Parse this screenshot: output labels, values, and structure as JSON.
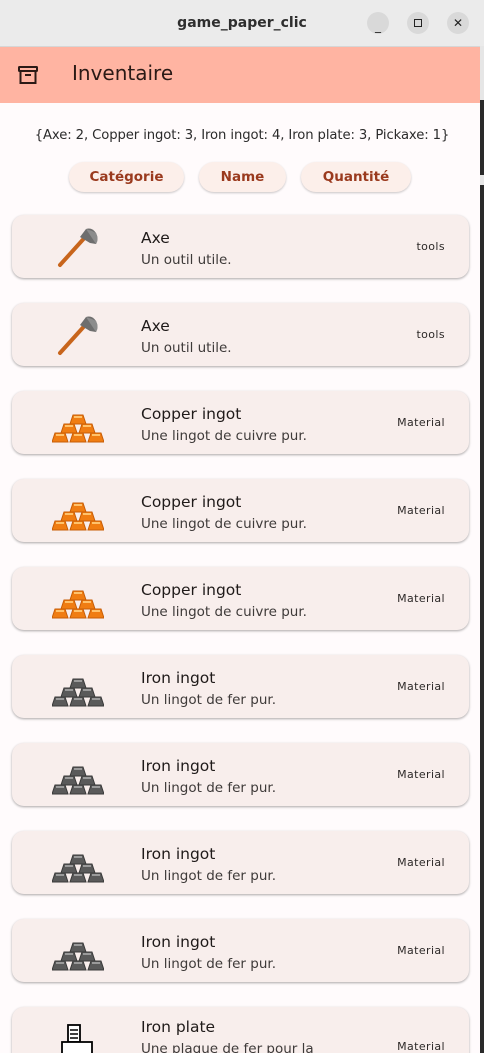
{
  "window": {
    "title": "game_paper_clic",
    "minimize_glyph": "_",
    "close_glyph": "✕"
  },
  "appbar": {
    "title": "Inventaire",
    "icon": "archive-icon",
    "background": "#ffb4a2"
  },
  "summary": "{Axe: 2, Copper ingot: 3, Iron ingot: 4, Iron plate: 3, Pickaxe: 1}",
  "sort_buttons": {
    "category": "Catégorie",
    "name": "Name",
    "quantity": "Quantité"
  },
  "items": [
    {
      "name": "Axe",
      "description": "Un outil utile.",
      "category": "tools",
      "icon": "axe-icon"
    },
    {
      "name": "Axe",
      "description": "Un outil utile.",
      "category": "tools",
      "icon": "axe-icon"
    },
    {
      "name": "Copper ingot",
      "description": "Une lingot de cuivre pur.",
      "category": "Material",
      "icon": "copper-ingot-icon"
    },
    {
      "name": "Copper ingot",
      "description": "Une lingot de cuivre pur.",
      "category": "Material",
      "icon": "copper-ingot-icon"
    },
    {
      "name": "Copper ingot",
      "description": "Une lingot de cuivre pur.",
      "category": "Material",
      "icon": "copper-ingot-icon"
    },
    {
      "name": "Iron ingot",
      "description": "Un lingot de fer pur.",
      "category": "Material",
      "icon": "iron-ingot-icon"
    },
    {
      "name": "Iron ingot",
      "description": "Un lingot de fer pur.",
      "category": "Material",
      "icon": "iron-ingot-icon"
    },
    {
      "name": "Iron ingot",
      "description": "Un lingot de fer pur.",
      "category": "Material",
      "icon": "iron-ingot-icon"
    },
    {
      "name": "Iron ingot",
      "description": "Un lingot de fer pur.",
      "category": "Material",
      "icon": "iron-ingot-icon"
    },
    {
      "name": "Iron plate",
      "description": "Une plaque de fer pour la",
      "category": "Material",
      "icon": "iron-plate-icon"
    }
  ],
  "colors": {
    "accent_text": "#9a3a1e",
    "card_bg": "#f8eeec",
    "copper": "#f07d12",
    "iron": "#5a5a5a"
  }
}
